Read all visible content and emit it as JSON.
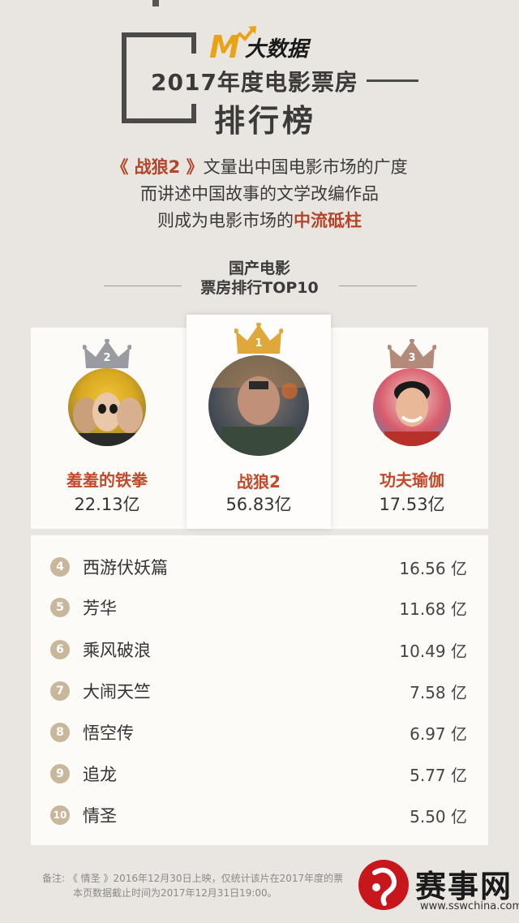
{
  "header": {
    "logo_mark": "M",
    "logo_text": "大数据",
    "title_line1": "2017年度电影票房",
    "title_line2": "排行榜"
  },
  "intro": {
    "line1_accent": "《 战狼2 》",
    "line1_rest": "文量出中国电影市场的广度",
    "line2": "而讲述中国故事的文学改编作品",
    "line3_prefix": "则成为电影市场的",
    "line3_accent": "中流砥柱"
  },
  "section": {
    "line1": "国产电影",
    "line2": "票房排行TOP10"
  },
  "podium": [
    {
      "rank": "2",
      "name": "羞羞的铁拳",
      "value": "22.13亿",
      "crown_color": "#9a9aa2"
    },
    {
      "rank": "1",
      "name": "战狼2",
      "value": "56.83亿",
      "crown_color": "#e0a83a"
    },
    {
      "rank": "3",
      "name": "功夫瑜伽",
      "value": "17.53亿",
      "crown_color": "#b48a7a"
    }
  ],
  "list": [
    {
      "rank": "4",
      "name": "西游伏妖篇",
      "value": "16.56 亿"
    },
    {
      "rank": "5",
      "name": "芳华",
      "value": "11.68 亿"
    },
    {
      "rank": "6",
      "name": "乘风破浪",
      "value": "10.49 亿"
    },
    {
      "rank": "7",
      "name": "大闹天竺",
      "value": "7.58 亿"
    },
    {
      "rank": "8",
      "name": "悟空传",
      "value": "6.97 亿"
    },
    {
      "rank": "9",
      "name": "追龙",
      "value": "5.77 亿"
    },
    {
      "rank": "10",
      "name": "情圣",
      "value": "5.50 亿"
    }
  ],
  "footnote": {
    "line1": "备注: 《 情圣 》2016年12月30日上映，仅统计该片在2017年度的票",
    "line2": "本页数据截止时间为2017年12月31日19:00。"
  },
  "watermark": {
    "name": "赛事网",
    "url": "www.sswchina.com"
  },
  "colors": {
    "accent_red": "#c24a2a",
    "gold": "#e0a83a",
    "rank_badge": "#c9b79c"
  }
}
